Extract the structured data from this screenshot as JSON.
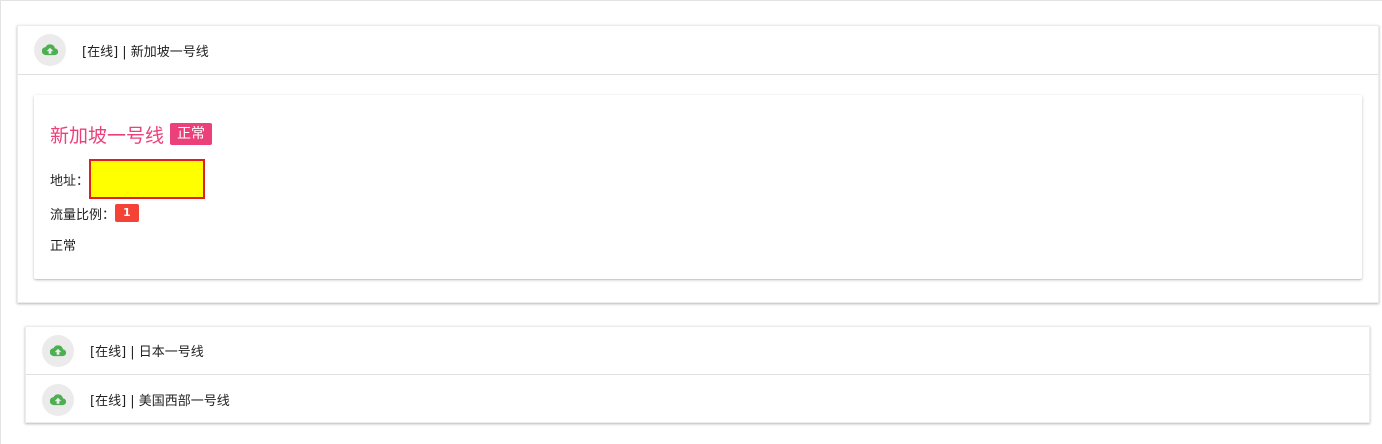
{
  "servers": [
    {
      "header": "[在线] | 新加坡一号线",
      "title": "新加坡一号线",
      "status_badge": "正常",
      "address_label": "地址：",
      "ratio_label": "流量比例：",
      "ratio_value": "1",
      "description": "正常"
    },
    {
      "header": "[在线] | 日本一号线"
    },
    {
      "header": "[在线] | 美国西部一号线"
    }
  ],
  "icons": {
    "status": "cloud-upload-icon"
  },
  "colors": {
    "accent": "#ec407a",
    "ratio_badge": "#f44336",
    "icon_green": "#4caf50",
    "highlight_fill": "#ffff00",
    "highlight_border": "#e02020"
  }
}
